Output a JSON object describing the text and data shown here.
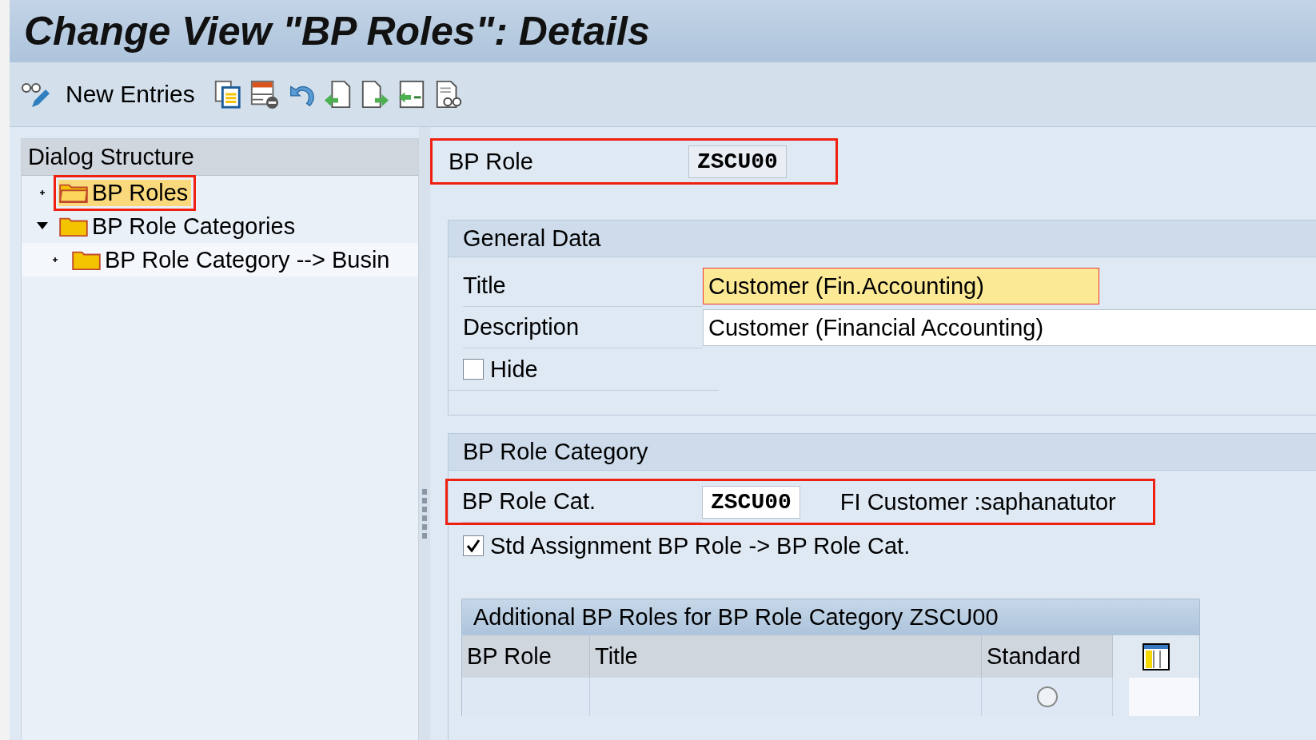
{
  "window": {
    "title": "Change View \"BP Roles\": Details"
  },
  "toolbar": {
    "new_entries": "New Entries"
  },
  "dialog_structure": {
    "title": "Dialog Structure",
    "items": [
      {
        "label": "BP Roles",
        "selected": true,
        "expanded": false,
        "highlighted": true
      },
      {
        "label": "BP Role Categories",
        "selected": false,
        "expanded": true,
        "highlighted": false,
        "children": [
          {
            "label": "BP Role Category --> Busin",
            "selected": false,
            "expanded": false,
            "highlighted": false
          }
        ]
      }
    ]
  },
  "bp_role": {
    "label": "BP Role",
    "value": "ZSCU00",
    "highlighted": true
  },
  "general_data": {
    "title": "General Data",
    "title_field": {
      "label": "Title",
      "value": "Customer (Fin.Accounting)"
    },
    "description": {
      "label": "Description",
      "value": "Customer (Financial Accounting)"
    },
    "hide": {
      "label": "Hide",
      "checked": false
    }
  },
  "bp_role_category": {
    "title": "BP Role Category",
    "field": {
      "label": "BP Role Cat.",
      "value": "ZSCU00",
      "text": "FI Customer :saphanatutor",
      "highlighted": true
    },
    "std_assignment": {
      "label": "Std Assignment BP Role -> BP Role Cat.",
      "checked": true
    }
  },
  "additional_roles": {
    "title": "Additional BP Roles for BP Role Category ZSCU00",
    "columns": [
      "BP Role",
      "Title",
      "Standard"
    ],
    "rows": [
      {
        "standard_selected": false
      }
    ]
  }
}
